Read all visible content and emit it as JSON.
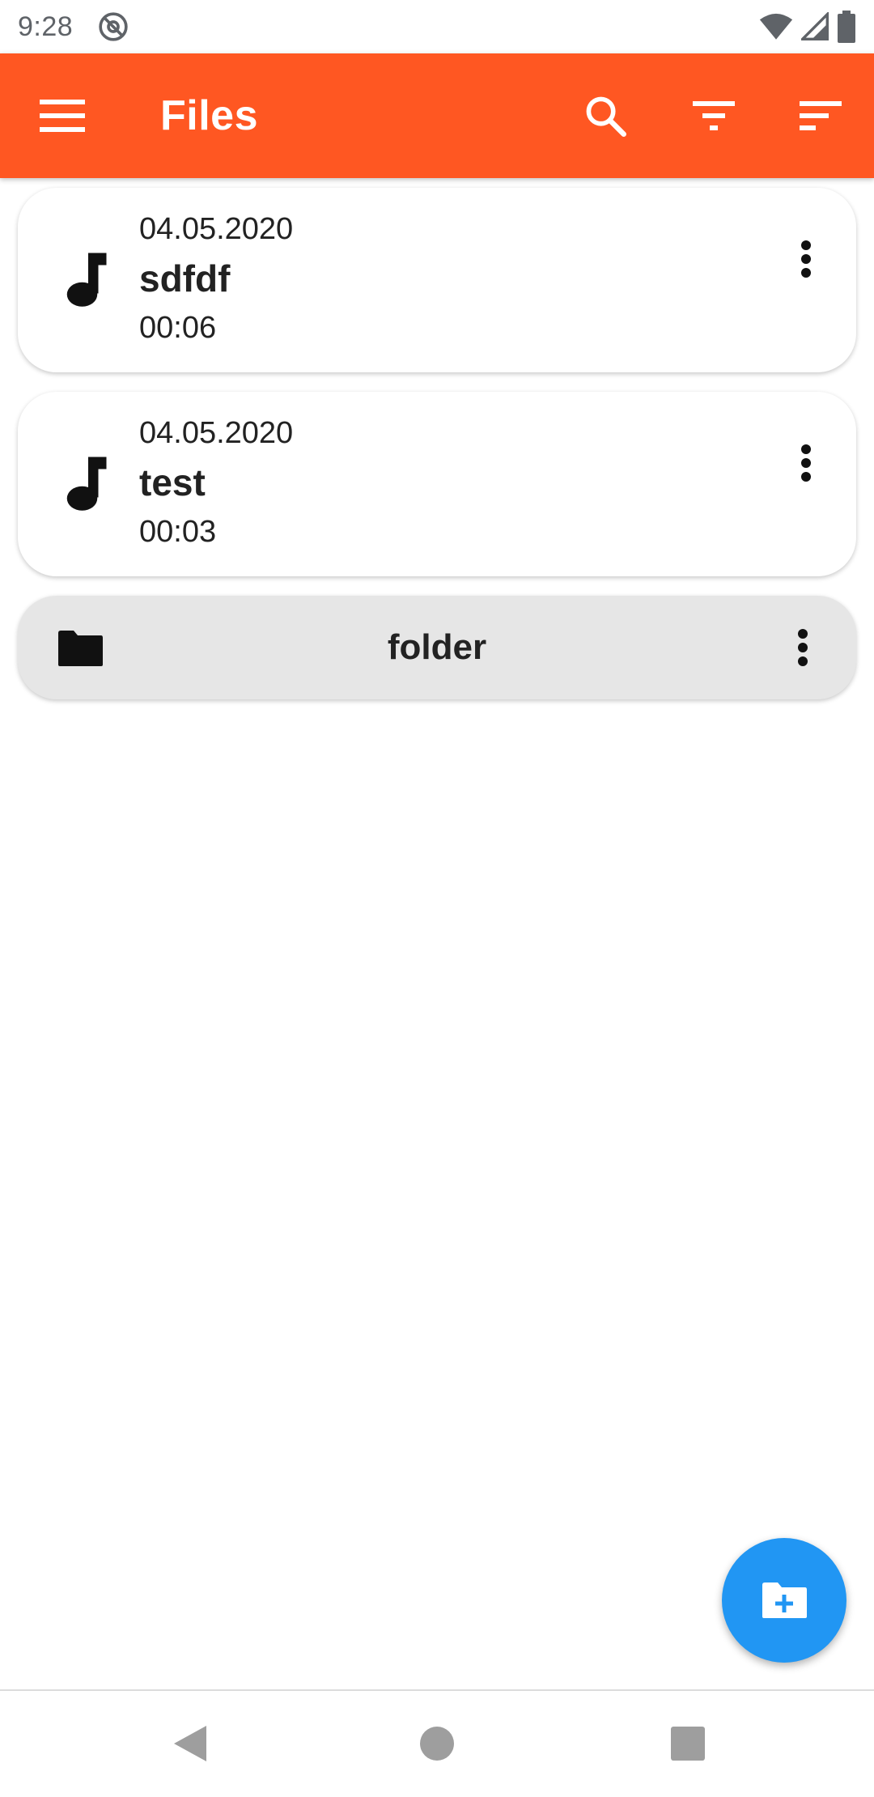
{
  "status_bar": {
    "time": "9:28",
    "icons": [
      "at-sign-icon",
      "wifi-icon",
      "signal-icon",
      "battery-icon"
    ]
  },
  "app_bar": {
    "title": "Files",
    "background_color": "#FF5722",
    "icons": [
      "menu-icon",
      "search-icon",
      "filter-icon",
      "sort-icon"
    ]
  },
  "files": [
    {
      "date": "04.05.2020",
      "name": "sdfdf",
      "duration": "00:06",
      "icon": "music-note-icon"
    },
    {
      "date": "04.05.2020",
      "name": "test",
      "duration": "00:03",
      "icon": "music-note-icon"
    }
  ],
  "folders": [
    {
      "name": "folder",
      "icon": "folder-icon"
    }
  ],
  "fab": {
    "icon": "create-folder-icon",
    "color": "#2196F3"
  },
  "nav_bar": {
    "icons": [
      "back-icon",
      "home-icon",
      "recents-icon"
    ]
  }
}
